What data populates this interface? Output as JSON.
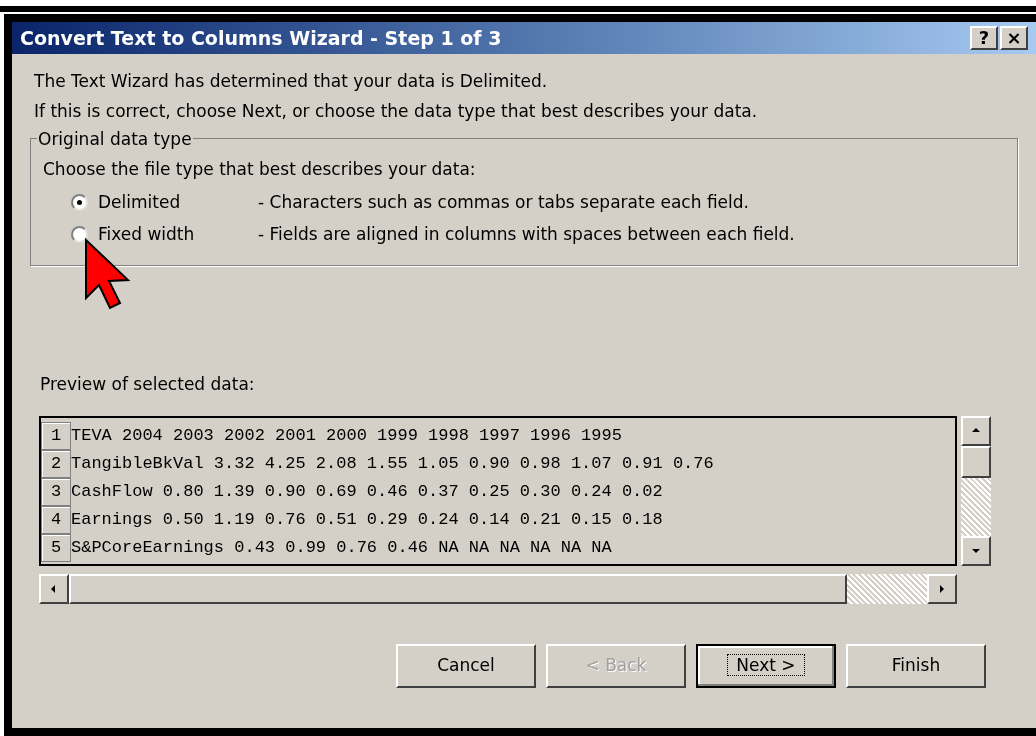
{
  "window": {
    "title": "Convert Text to Columns Wizard - Step 1 of 3",
    "title_buttons": [
      "?",
      "×"
    ]
  },
  "intro": [
    "The Text Wizard has determined that your data is Delimited.",
    "If this is correct, choose Next, or choose the data type that best describes your data."
  ],
  "group": {
    "title": "Original data type",
    "prompt": "Choose the file type that best describes your data:",
    "options": [
      {
        "label": "Delimited",
        "description": "- Characters such as commas or tabs separate each field.",
        "selected": true
      },
      {
        "label": "Fixed width",
        "description": "- Fields are aligned in columns with spaces between each field.",
        "selected": false
      }
    ]
  },
  "preview": {
    "label": "Preview of selected data:",
    "rows": [
      {
        "number": "1",
        "text": "TEVA 2004 2003 2002 2001 2000 1999 1998 1997 1996 1995"
      },
      {
        "number": "2",
        "text": "TangibleBkVal 3.32 4.25 2.08 1.55 1.05 0.90 0.98 1.07 0.91 0.76"
      },
      {
        "number": "3",
        "text": "CashFlow 0.80 1.39 0.90 0.69 0.46 0.37 0.25 0.30 0.24 0.02"
      },
      {
        "number": "4",
        "text": "Earnings 0.50 1.19 0.76 0.51 0.29 0.24 0.14 0.21 0.15 0.18"
      },
      {
        "number": "5",
        "text": "S&PCoreEarnings 0.43 0.99 0.76 0.46 NA NA NA NA NA NA"
      }
    ]
  },
  "buttons": [
    {
      "label": "Cancel",
      "disabled": false,
      "default": false
    },
    {
      "label": "< Back",
      "disabled": true,
      "default": false
    },
    {
      "label": "Next >",
      "disabled": false,
      "default": true
    },
    {
      "label": "Finish",
      "disabled": false,
      "default": false
    }
  ]
}
